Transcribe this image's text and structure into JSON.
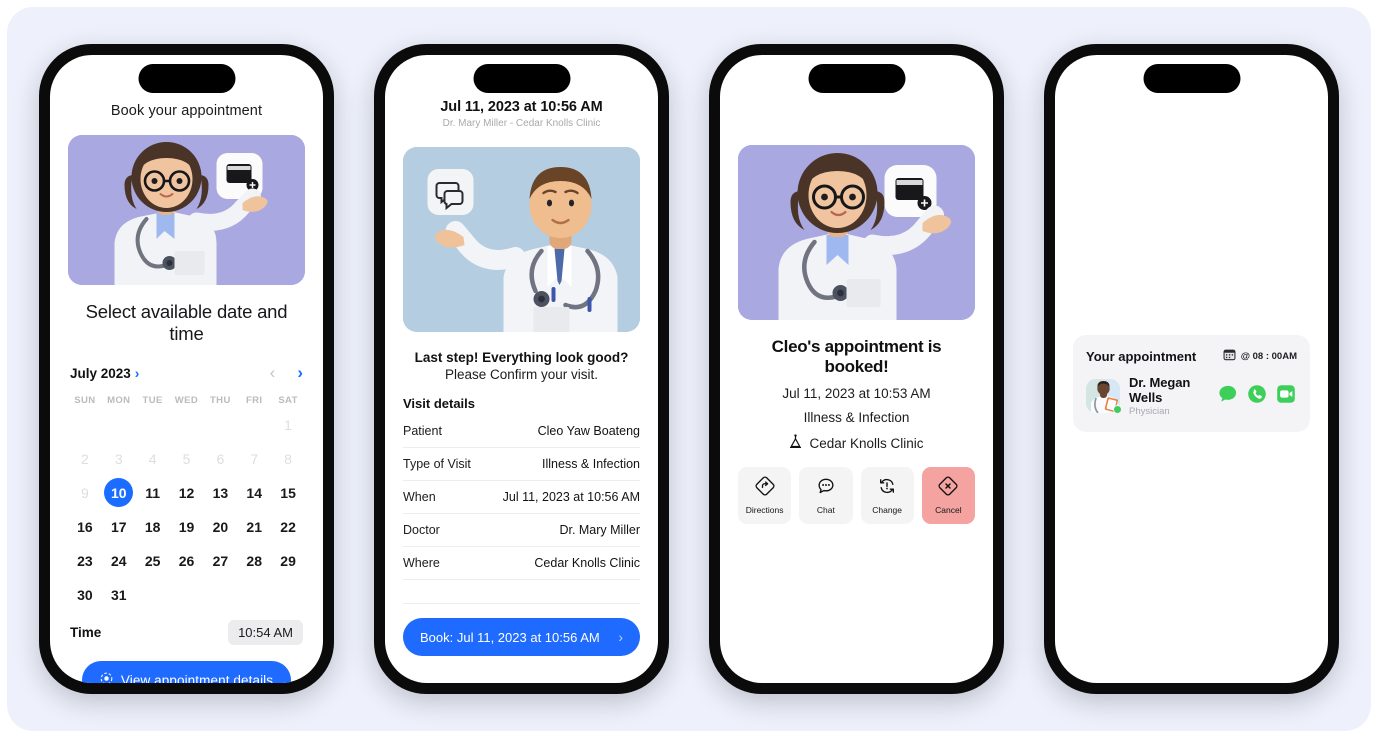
{
  "theme": {
    "accent": "#1f6bff",
    "danger": "#f4a3a0",
    "green": "#3ecf5b",
    "canvas_bg": "#eef1fb"
  },
  "screen1": {
    "title": "Book your appointment",
    "subtitle": "Select available date and time",
    "illustration": "female-doctor-calendar-illustration",
    "calendar": {
      "month_label": "July 2023",
      "month_chevron": "›",
      "prev_icon": "‹",
      "next_icon": "›",
      "weekdays": [
        "SUN",
        "MON",
        "TUE",
        "WED",
        "THU",
        "FRI",
        "SAT"
      ],
      "lead_blanks": 6,
      "days": [
        {
          "n": "1",
          "state": "dim"
        },
        {
          "n": "2",
          "state": "dim"
        },
        {
          "n": "3",
          "state": "dim"
        },
        {
          "n": "4",
          "state": "dim"
        },
        {
          "n": "5",
          "state": "dim"
        },
        {
          "n": "6",
          "state": "dim"
        },
        {
          "n": "7",
          "state": "dim"
        },
        {
          "n": "8",
          "state": "dim"
        },
        {
          "n": "9",
          "state": "dim"
        },
        {
          "n": "10",
          "state": "selected"
        },
        {
          "n": "11",
          "state": "normal"
        },
        {
          "n": "12",
          "state": "normal"
        },
        {
          "n": "13",
          "state": "normal"
        },
        {
          "n": "14",
          "state": "normal"
        },
        {
          "n": "15",
          "state": "normal"
        },
        {
          "n": "16",
          "state": "normal"
        },
        {
          "n": "17",
          "state": "normal"
        },
        {
          "n": "18",
          "state": "normal"
        },
        {
          "n": "19",
          "state": "normal"
        },
        {
          "n": "20",
          "state": "normal"
        },
        {
          "n": "21",
          "state": "normal"
        },
        {
          "n": "22",
          "state": "normal"
        },
        {
          "n": "23",
          "state": "normal"
        },
        {
          "n": "24",
          "state": "normal"
        },
        {
          "n": "25",
          "state": "normal"
        },
        {
          "n": "26",
          "state": "normal"
        },
        {
          "n": "27",
          "state": "normal"
        },
        {
          "n": "28",
          "state": "normal"
        },
        {
          "n": "29",
          "state": "normal"
        },
        {
          "n": "30",
          "state": "normal"
        },
        {
          "n": "31",
          "state": "normal"
        }
      ]
    },
    "time_label": "Time",
    "time_value": "10:54 AM",
    "cta_label": "View appointment details",
    "cta_icon": "focus-target-icon"
  },
  "screen2": {
    "header_title": "Jul 11, 2023 at 10:56 AM",
    "header_sub": "Dr. Mary Miller - Cedar Knolls Clinic",
    "illustration": "male-doctor-chat-illustration",
    "confirm_line1": "Last step! Everything look good?",
    "confirm_line2": "Please Confirm your visit.",
    "section_title": "Visit details",
    "details": [
      {
        "key": "Patient",
        "value": "Cleo Yaw Boateng"
      },
      {
        "key": "Type of Visit",
        "value": "Illness & Infection"
      },
      {
        "key": "When",
        "value": "Jul 11, 2023 at 10:56 AM"
      },
      {
        "key": "Doctor",
        "value": "Dr. Mary Miller"
      },
      {
        "key": "Where",
        "value": "Cedar Knolls Clinic"
      }
    ],
    "book_label": "Book: Jul 11, 2023 at 10:56 AM",
    "book_chevron": "›"
  },
  "screen3": {
    "illustration": "female-doctor-calendar-illustration",
    "title": "Cleo's appointment is booked!",
    "datetime": "Jul 11, 2023 at 10:53 AM",
    "visit_type": "Illness & Infection",
    "location": "Cedar Knolls Clinic",
    "actions": [
      {
        "label": "Directions",
        "icon": "directions-diamond-icon",
        "variant": "normal"
      },
      {
        "label": "Chat",
        "icon": "chat-bubble-icon",
        "variant": "normal"
      },
      {
        "label": "Change",
        "icon": "change-refresh-icon",
        "variant": "normal"
      },
      {
        "label": "Cancel",
        "icon": "cancel-x-diamond-icon",
        "variant": "danger"
      }
    ]
  },
  "screen4": {
    "card_title": "Your appointment",
    "card_time": "@ 08 : 00AM",
    "calendar_icon": "calendar-icon",
    "doctor_name": "Dr. Megan Wells",
    "doctor_role": "Physician",
    "avatar": "doctor-avatar",
    "status": "online",
    "comms": [
      {
        "icon": "message-bubble-icon"
      },
      {
        "icon": "phone-call-icon"
      },
      {
        "icon": "video-camera-icon"
      }
    ]
  }
}
